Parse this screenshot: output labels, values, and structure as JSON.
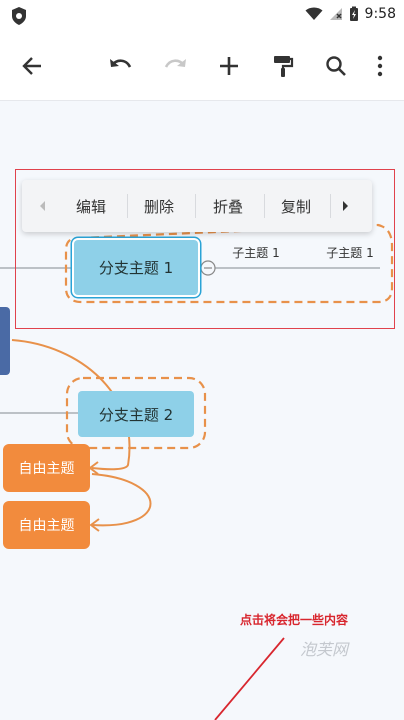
{
  "status_bar": {
    "time": "9:58"
  },
  "toolbar": {
    "back_icon": "arrow-left-icon",
    "undo_icon": "undo-icon",
    "redo_icon": "redo-icon",
    "add_icon": "plus-icon",
    "format_icon": "paint-roller-icon",
    "search_icon": "search-icon",
    "more_icon": "more-vertical-icon"
  },
  "context_menu": {
    "items": [
      "编辑",
      "删除",
      "折叠",
      "复制"
    ]
  },
  "nodes": {
    "branch1": "分支主题 1",
    "branch2": "分支主题 2",
    "sub1": "子主题 1",
    "sub2": "子主题 1",
    "free1": "自由主题",
    "free2": "自由主题"
  },
  "annotation": "点击将会把一些内容",
  "watermark": "泡芙网",
  "colors": {
    "selection_border": "#e0424c",
    "branch_fill": "#8ed0e8",
    "free_fill": "#f28b3d",
    "dashed_outline": "#e8914a",
    "connector": "#e8914a",
    "side_node": "#4a6aa5"
  }
}
